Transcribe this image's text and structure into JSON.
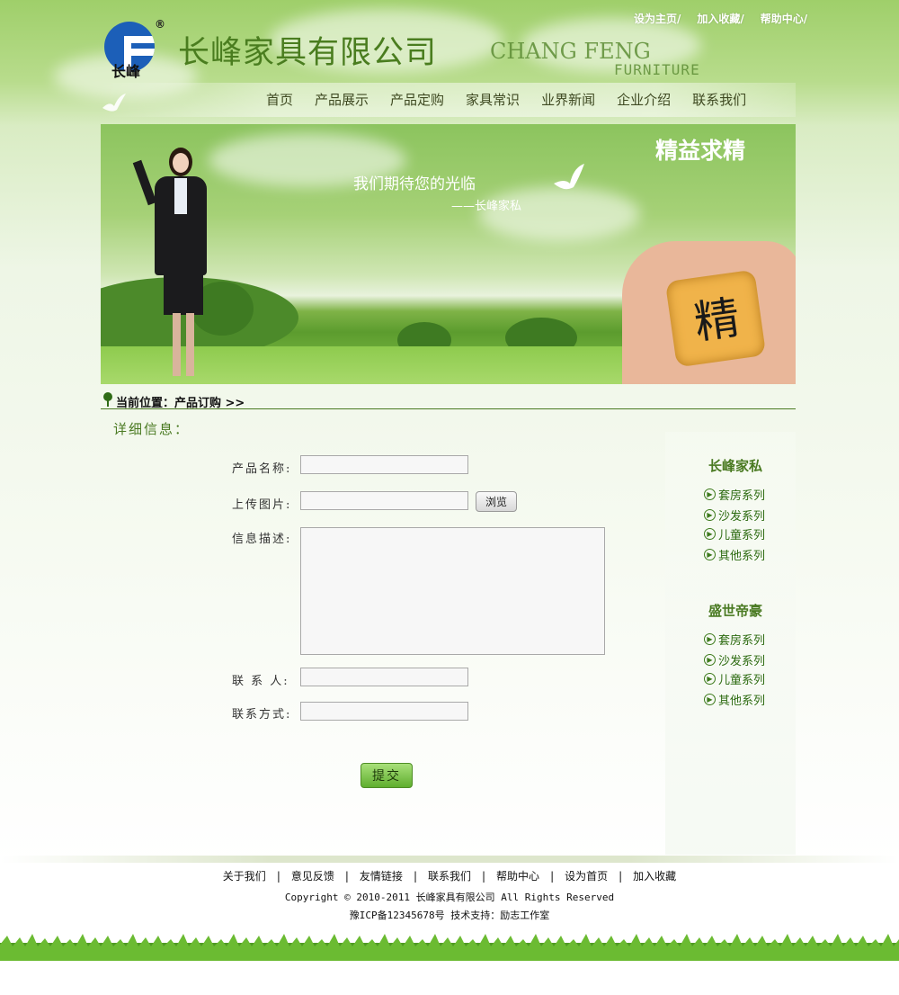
{
  "header": {
    "logo_text": "长峰",
    "logo_reg": "®",
    "company_name": "长峰家具有限公司",
    "brand_en_line1": "CHANG FENG",
    "brand_en_line2": "FURNITURE",
    "top_links": [
      "设为主页/",
      "加入收藏/",
      "帮助中心/"
    ]
  },
  "nav": {
    "items": [
      "首页",
      "产品展示",
      "产品定购",
      "家具常识",
      "业界新闻",
      "企业介绍",
      "联系我们"
    ]
  },
  "banner": {
    "slogan": "精益求精",
    "text1": "我们期待您的光临",
    "text2": "——长峰家私",
    "cube_char": "精"
  },
  "breadcrumb": {
    "text": "当前位置：产品订购 >>"
  },
  "section": {
    "title": "详细信息："
  },
  "form": {
    "product_name_label": "产品名称:",
    "upload_label": "上传图片:",
    "browse_label": "浏览",
    "description_label": "信息描述:",
    "contact_label": "联 系 人:",
    "contact_method_label": "联系方式:",
    "submit_label": "提交"
  },
  "sidebar": {
    "groups": [
      {
        "title": "长峰家私",
        "items": [
          "套房系列",
          "沙发系列",
          "儿童系列",
          "其他系列"
        ]
      },
      {
        "title": "盛世帝豪",
        "items": [
          "套房系列",
          "沙发系列",
          "儿童系列",
          "其他系列"
        ]
      }
    ]
  },
  "footer": {
    "links": [
      "关于我们",
      "意见反馈",
      "友情链接",
      "联系我们",
      "帮助中心",
      "设为首页",
      "加入收藏"
    ],
    "separator": "|",
    "copyright": "Copyright © 2010-2011 长峰家具有限公司  All Rights Reserved",
    "icp": "豫ICP备12345678号    技术支持：励志工作室"
  },
  "colors": {
    "accent_green": "#4a7a22",
    "sky_green": "#9fcf6a",
    "link_green": "#2c6a10"
  }
}
